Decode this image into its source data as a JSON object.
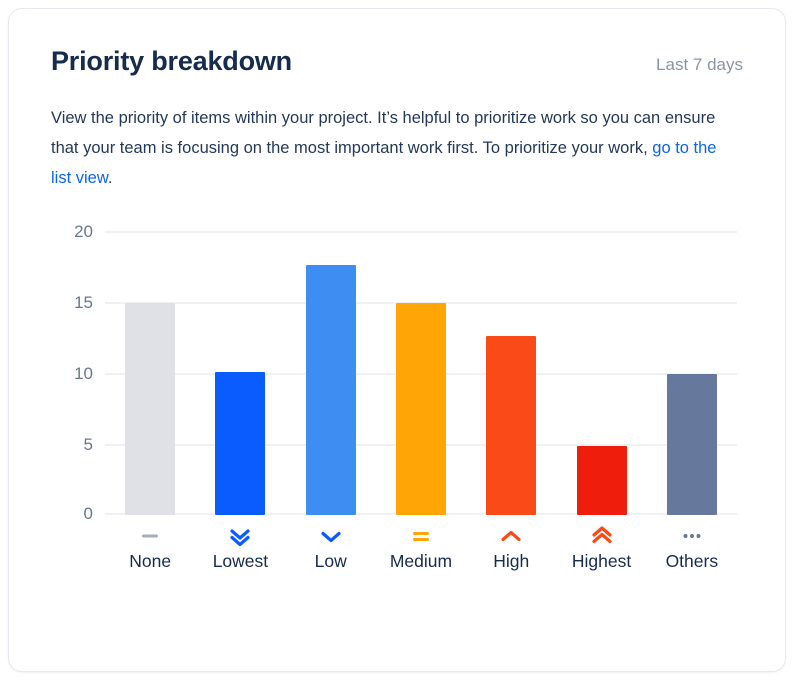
{
  "card": {
    "title": "Priority breakdown",
    "period": "Last 7 days",
    "description": {
      "part1": "View the priority of items within your project. It’s helpful to prioritize work so you can ensure that your team is focusing on the most important work first. To prioritize your work, ",
      "link_text": "go to the list view",
      "part2": "."
    }
  },
  "chart_data": {
    "type": "bar",
    "title": "Priority breakdown",
    "subtitle": "Last 7 days",
    "xlabel": "",
    "ylabel": "",
    "ylim": [
      0,
      20
    ],
    "yticks": [
      "0",
      "5",
      "10",
      "15",
      "20"
    ],
    "ytick_values": [
      0,
      5,
      10,
      15,
      20
    ],
    "grid": true,
    "legend": false,
    "categories": [
      "None",
      "Lowest",
      "Low",
      "Medium",
      "High",
      "Highest",
      "Others"
    ],
    "values": [
      15,
      10.1,
      17.7,
      15,
      12.7,
      4.9,
      10
    ],
    "colors": [
      "#dfe1e6",
      "#0b5cff",
      "#3d8df3",
      "#ffa505",
      "#fa4a17",
      "#ef1d0b",
      "#66789b"
    ],
    "icons": [
      "priority-none-dash-icon",
      "priority-lowest-double-chevron-down-icon",
      "priority-low-chevron-down-icon",
      "priority-medium-equals-icon",
      "priority-high-chevron-up-icon",
      "priority-highest-double-chevron-up-icon",
      "priority-others-ellipsis-icon"
    ],
    "icon_colors": [
      "#a5adba",
      "#0b5cff",
      "#0b5cff",
      "#ffa505",
      "#fa4a17",
      "#fa4a17",
      "#6b778c"
    ]
  }
}
